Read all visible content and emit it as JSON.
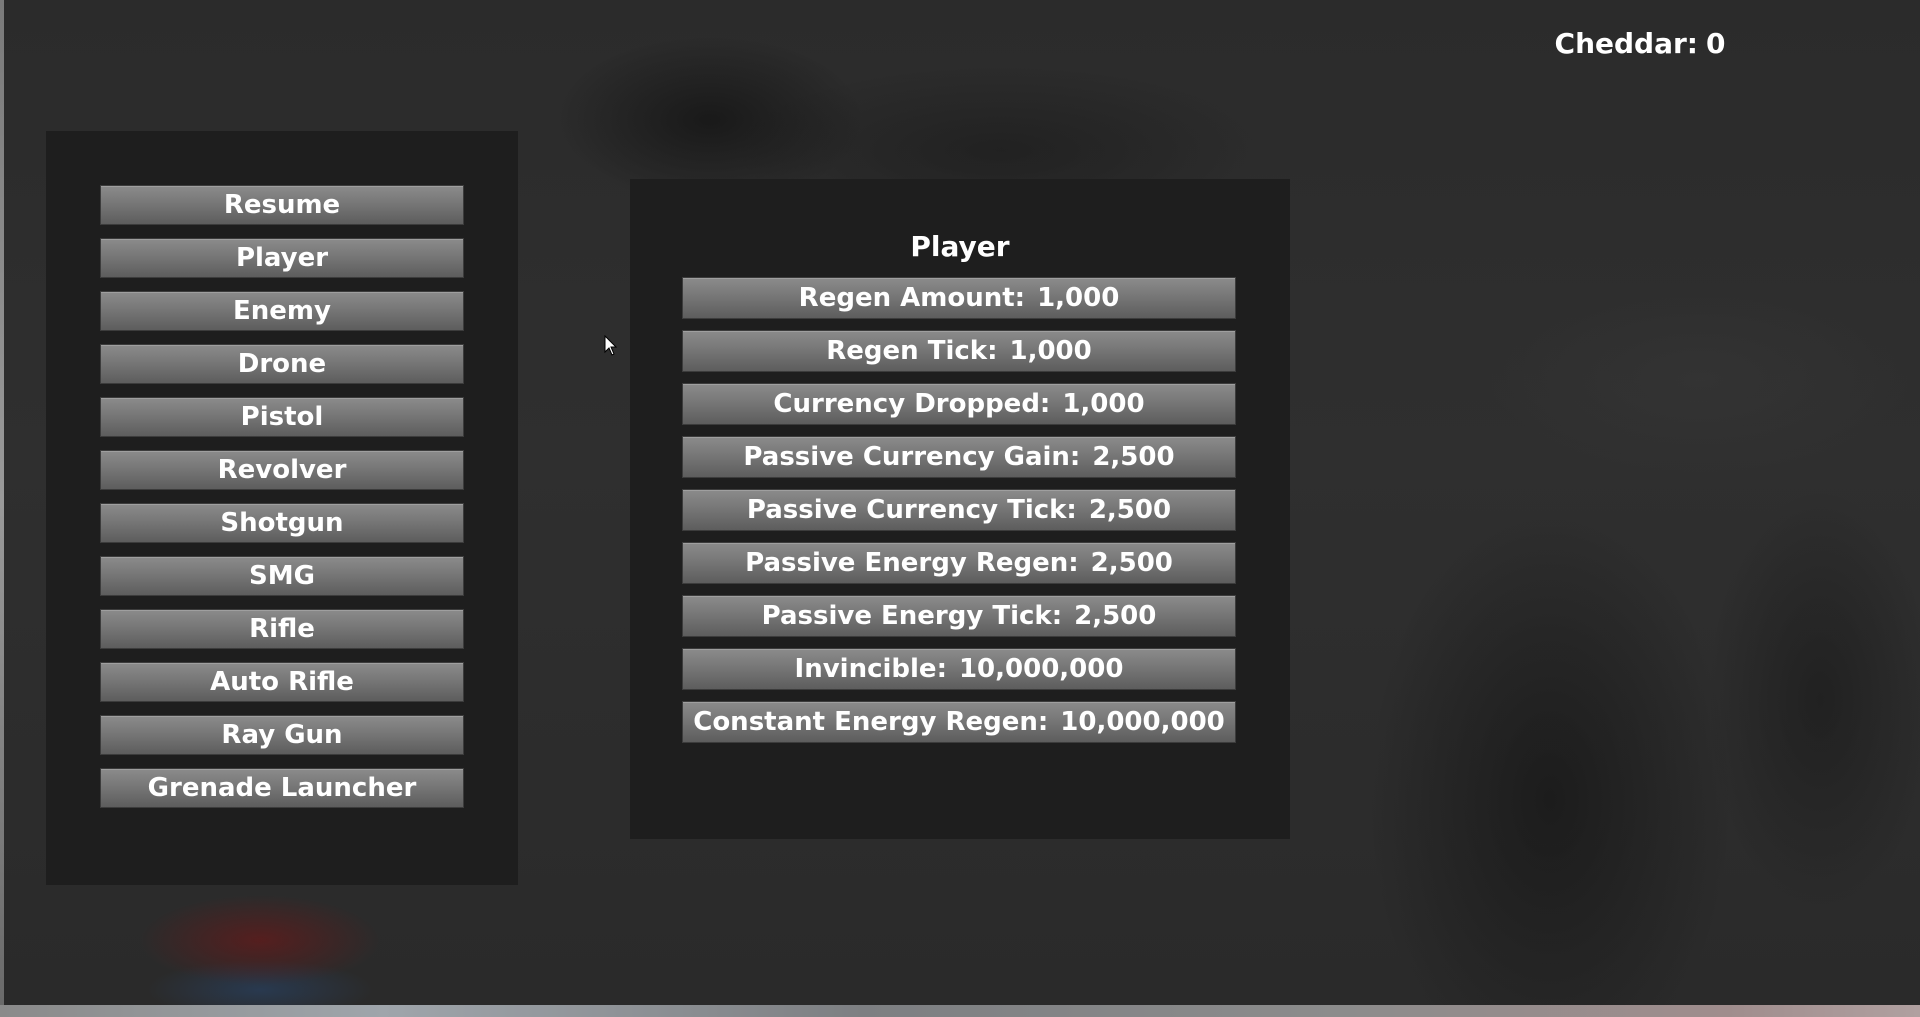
{
  "hud": {
    "currency_label": "Cheddar:",
    "currency_value": "0"
  },
  "menu": {
    "items": [
      {
        "label": "Resume"
      },
      {
        "label": "Player"
      },
      {
        "label": "Enemy"
      },
      {
        "label": "Drone"
      },
      {
        "label": "Pistol"
      },
      {
        "label": "Revolver"
      },
      {
        "label": "Shotgun"
      },
      {
        "label": "SMG"
      },
      {
        "label": "Rifle"
      },
      {
        "label": "Auto Rifle"
      },
      {
        "label": "Ray Gun"
      },
      {
        "label": "Grenade Launcher"
      }
    ]
  },
  "upgrades": {
    "title": "Player",
    "items": [
      {
        "label": "Regen Amount:",
        "cost": "1,000"
      },
      {
        "label": "Regen Tick:",
        "cost": "1,000"
      },
      {
        "label": "Currency Dropped:",
        "cost": "1,000"
      },
      {
        "label": "Passive Currency Gain:",
        "cost": "2,500"
      },
      {
        "label": "Passive Currency Tick:",
        "cost": "2,500"
      },
      {
        "label": "Passive Energy Regen:",
        "cost": "2,500"
      },
      {
        "label": "Passive Energy Tick:",
        "cost": "2,500"
      },
      {
        "label": "Invincible:",
        "cost": "10,000,000"
      },
      {
        "label": "Constant Energy Regen:",
        "cost": "10,000,000"
      }
    ]
  },
  "icons": {
    "cursor": "mouse-pointer-icon"
  },
  "colors": {
    "panel": "#1e1e1e",
    "button": "#777777",
    "text": "#ffffff"
  }
}
